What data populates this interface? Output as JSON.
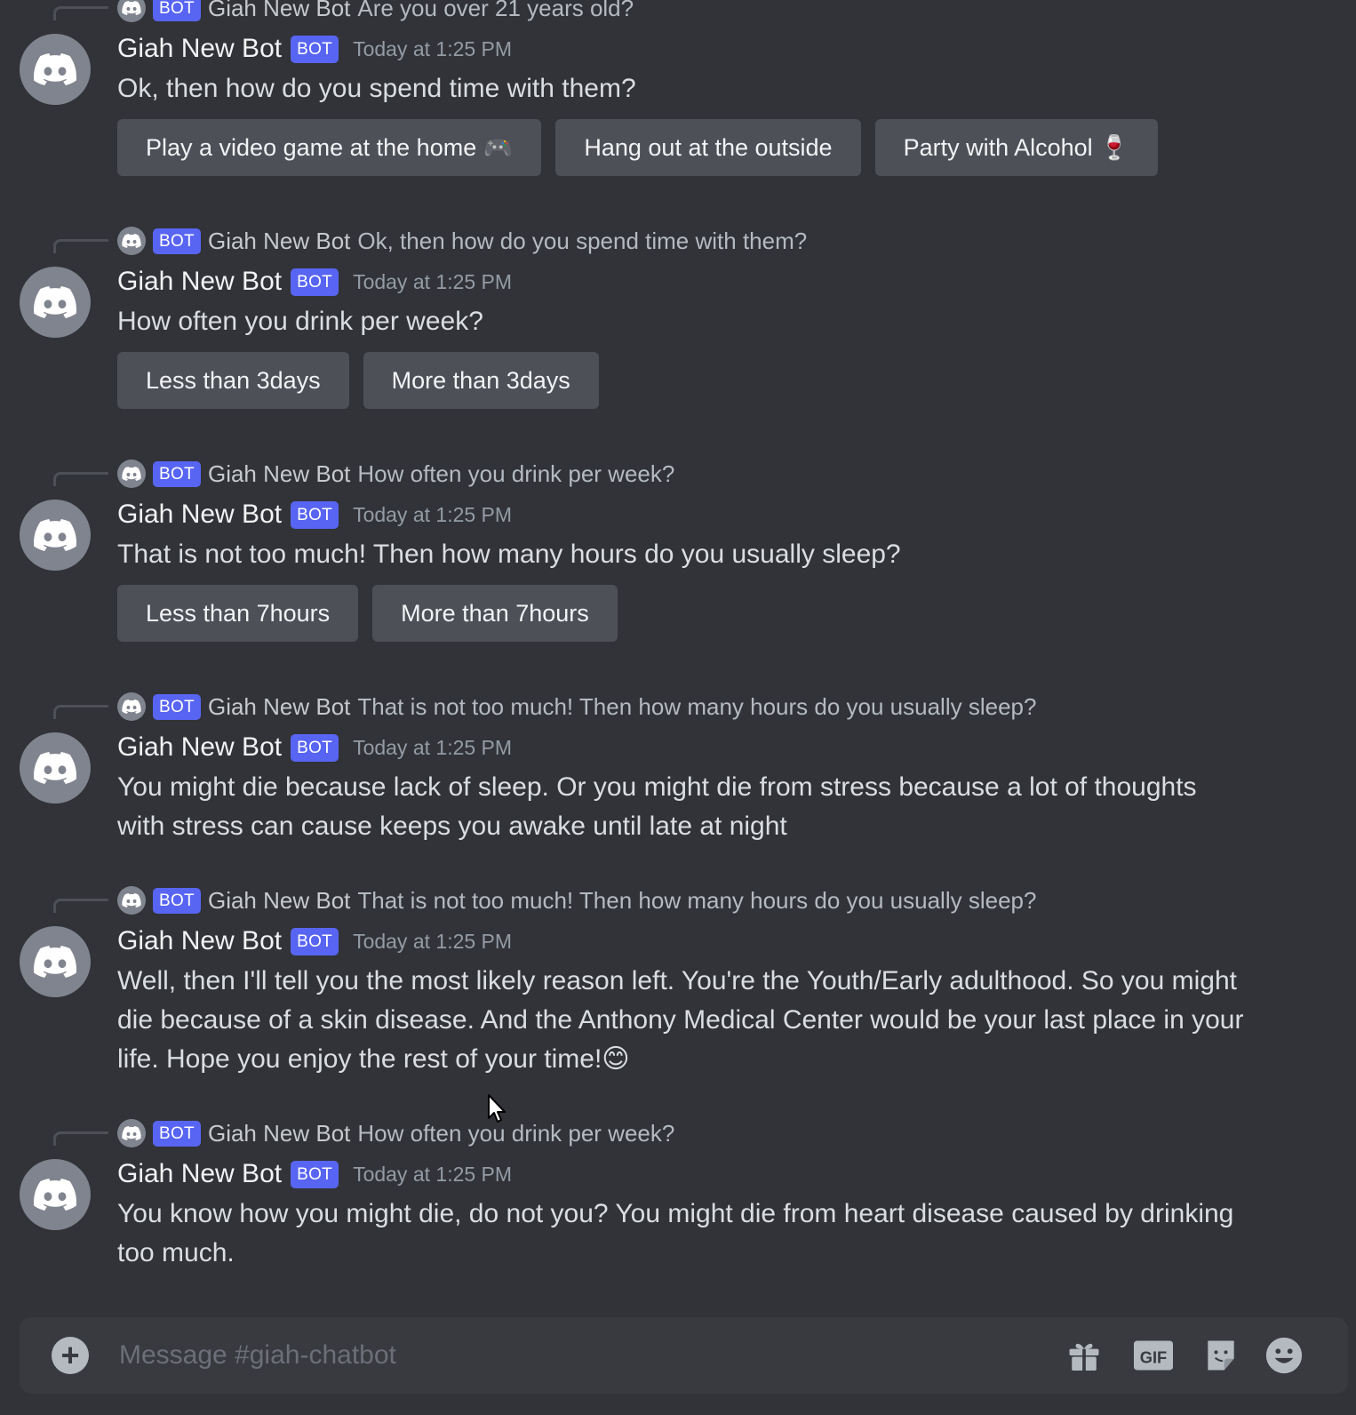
{
  "bot": {
    "name": "Giah New Bot",
    "badge": "BOT"
  },
  "messages": [
    {
      "reply": "Are you over 21 years old?",
      "timestamp": "Today at 1:25 PM",
      "content": "Ok, then how do you spend time with them?",
      "buttons": [
        "Play a video game at the home 🎮",
        "Hang out at the outside",
        "Party with Alcohol 🍷"
      ]
    },
    {
      "reply": "Ok, then how do you spend time with them?",
      "timestamp": "Today at 1:25 PM",
      "content": "How often you drink per week?",
      "buttons": [
        "Less than 3days",
        "More than 3days"
      ]
    },
    {
      "reply": "How often you drink per week?",
      "timestamp": "Today at 1:25 PM",
      "content": "That is not too much! Then how many hours do you usually sleep?",
      "buttons": [
        "Less than 7hours",
        "More than 7hours"
      ]
    },
    {
      "reply": "That is not too much! Then how many hours do you usually sleep?",
      "timestamp": "Today at 1:25 PM",
      "content": "You might die because lack of sleep. Or you might die from stress because a lot of thoughts with stress can cause keeps you awake until late at night"
    },
    {
      "reply": "That is not too much! Then how many hours do you usually sleep?",
      "timestamp": "Today at 1:25 PM",
      "content": "Well, then I'll tell you the most likely reason left. You're the Youth/Early adulthood. So you might die because of a skin disease. And the Anthony Medical Center would be your last place in your life. Hope you enjoy the rest of your time!😊"
    },
    {
      "reply": "How often you drink per week?",
      "timestamp": "Today at 1:25 PM",
      "content": "You know how you might die, do not you? You might die from heart disease caused by drinking too much."
    }
  ],
  "composer": {
    "placeholder": "Message #giah-chatbot",
    "icons": [
      "add-attachment-icon",
      "gift-icon",
      "gif-icon",
      "sticker-icon",
      "emoji-icon"
    ],
    "gif_label": "GIF"
  },
  "colors": {
    "background": "#313338",
    "composer": "#383a40",
    "button": "#4e5058",
    "badge": "#5865f2",
    "avatar": "#80848e"
  }
}
